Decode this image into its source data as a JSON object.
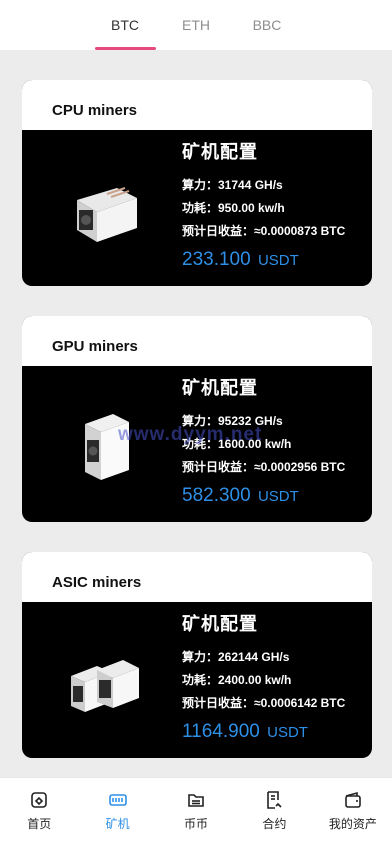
{
  "tabs": [
    {
      "label": "BTC",
      "active": true
    },
    {
      "label": "ETH",
      "active": false
    },
    {
      "label": "BBC",
      "active": false
    }
  ],
  "config_heading": "矿机配置",
  "miners": [
    {
      "title": "CPU miners",
      "hashrate": "算力：31744 GH/s",
      "power": "功耗：950.00 kw/h",
      "income": "预计日收益：≈0.0000873 BTC",
      "price": "233.100",
      "unit": "USDT"
    },
    {
      "title": "GPU miners",
      "hashrate": "算力：95232 GH/s",
      "power": "功耗：1600.00 kw/h",
      "income": "预计日收益：≈0.0002956 BTC",
      "price": "582.300",
      "unit": "USDT"
    },
    {
      "title": "ASIC miners",
      "hashrate": "算力：262144 GH/s",
      "power": "功耗：2400.00 kw/h",
      "income": "预计日收益：≈0.0006142 BTC",
      "price": "1164.900",
      "unit": "USDT"
    }
  ],
  "watermark": "www.dyym.net",
  "nav": [
    {
      "label": "首页",
      "icon": "home-icon",
      "active": false
    },
    {
      "label": "矿机",
      "icon": "miner-icon",
      "active": true
    },
    {
      "label": "币币",
      "icon": "wallet-folder-icon",
      "active": false
    },
    {
      "label": "合约",
      "icon": "contract-icon",
      "active": false
    },
    {
      "label": "我的资产",
      "icon": "wallet-icon",
      "active": false
    }
  ],
  "colors": {
    "accent": "#e6497c",
    "price": "#2e8fe6",
    "active_nav": "#2e8fe6"
  }
}
